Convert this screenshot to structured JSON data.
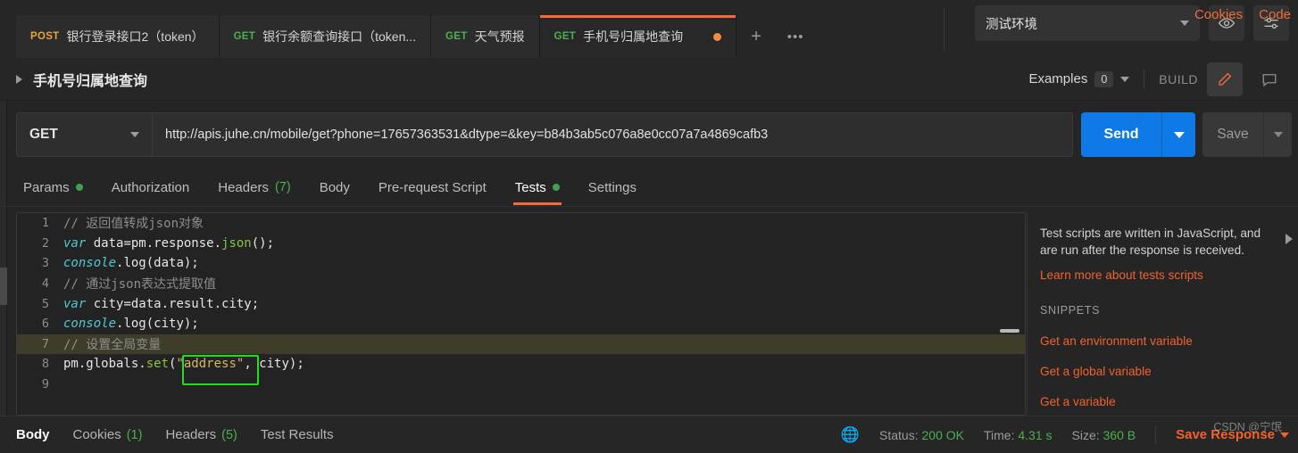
{
  "tabs": [
    {
      "method": "POST",
      "method_class": "m-post",
      "label": "银行登录接口2（token）",
      "active": false,
      "unsaved": false
    },
    {
      "method": "GET",
      "method_class": "m-get",
      "label": "银行余额查询接口（token...",
      "active": false,
      "unsaved": false
    },
    {
      "method": "GET",
      "method_class": "m-get",
      "label": "天气预报",
      "active": false,
      "unsaved": false
    },
    {
      "method": "GET",
      "method_class": "m-get",
      "label": "手机号归属地查询",
      "active": true,
      "unsaved": true
    }
  ],
  "tabbar": {
    "add_label": "+",
    "more_label": "•••"
  },
  "environment": {
    "selected": "测试环境",
    "eye_icon": "eye-icon",
    "settings_icon": "sliders-icon"
  },
  "request_header": {
    "title": "手机号归属地查询",
    "examples_label": "Examples",
    "examples_count": "0",
    "build_label": "BUILD",
    "edit_icon": "pencil-icon",
    "comment_icon": "comment-icon"
  },
  "url_bar": {
    "method": "GET",
    "url": "http://apis.juhe.cn/mobile/get?phone=17657363531&dtype=&key=b84b3ab5c076a8e0cc07a7a4869cafb3",
    "send_label": "Send",
    "save_label": "Save"
  },
  "request_tabs": [
    {
      "label": "Params",
      "dot": true,
      "count": "",
      "active": false
    },
    {
      "label": "Authorization",
      "dot": false,
      "count": "",
      "active": false
    },
    {
      "label": "Headers",
      "dot": false,
      "count": "(7)",
      "active": false
    },
    {
      "label": "Body",
      "dot": false,
      "count": "",
      "active": false
    },
    {
      "label": "Pre-request Script",
      "dot": false,
      "count": "",
      "active": false
    },
    {
      "label": "Tests",
      "dot": true,
      "count": "",
      "active": true
    },
    {
      "label": "Settings",
      "dot": false,
      "count": "",
      "active": false
    }
  ],
  "right_links": {
    "cookies": "Cookies",
    "code": "Code"
  },
  "editor": {
    "lines": [
      {
        "n": "1",
        "highlight": false,
        "tokens": [
          {
            "t": "// 返回值转成json对象",
            "c": "c-comment"
          }
        ]
      },
      {
        "n": "2",
        "highlight": false,
        "tokens": [
          {
            "t": "var",
            "c": "c-kw"
          },
          {
            "t": " data=pm.response.",
            "c": "c-plain"
          },
          {
            "t": "json",
            "c": "c-fn"
          },
          {
            "t": "();",
            "c": "c-plain"
          }
        ]
      },
      {
        "n": "3",
        "highlight": false,
        "tokens": [
          {
            "t": "console",
            "c": "c-obj"
          },
          {
            "t": ".log(data);",
            "c": "c-plain"
          }
        ]
      },
      {
        "n": "4",
        "highlight": false,
        "tokens": [
          {
            "t": "// 通过json表达式提取值",
            "c": "c-comment"
          }
        ]
      },
      {
        "n": "5",
        "highlight": false,
        "tokens": [
          {
            "t": "var",
            "c": "c-kw"
          },
          {
            "t": " city=data.result.city;",
            "c": "c-plain"
          }
        ]
      },
      {
        "n": "6",
        "highlight": false,
        "tokens": [
          {
            "t": "console",
            "c": "c-obj"
          },
          {
            "t": ".log(city);",
            "c": "c-plain"
          }
        ]
      },
      {
        "n": "7",
        "highlight": true,
        "tokens": [
          {
            "t": "// 设置全局变量",
            "c": "c-comment"
          }
        ]
      },
      {
        "n": "8",
        "highlight": false,
        "tokens": [
          {
            "t": "pm.globals.",
            "c": "c-plain"
          },
          {
            "t": "set",
            "c": "c-fn"
          },
          {
            "t": "(",
            "c": "c-plain"
          },
          {
            "t": "\"address\"",
            "c": "c-str"
          },
          {
            "t": ", city);",
            "c": "c-plain"
          }
        ]
      },
      {
        "n": "9",
        "highlight": false,
        "tokens": [
          {
            "t": "",
            "c": "c-plain"
          }
        ]
      }
    ]
  },
  "side_panel": {
    "description": "Test scripts are written in JavaScript, and are run after the response is received.",
    "learn_more": "Learn more about tests scripts",
    "snippets_title": "SNIPPETS",
    "snippets": [
      "Get an environment variable",
      "Get a global variable",
      "Get a variable"
    ]
  },
  "response_tabs": [
    {
      "label": "Body",
      "count": "",
      "active": true
    },
    {
      "label": "Cookies",
      "count": "(1)",
      "active": false
    },
    {
      "label": "Headers",
      "count": "(5)",
      "active": false
    },
    {
      "label": "Test Results",
      "count": "",
      "active": false
    }
  ],
  "status_bar": {
    "globe_icon": "globe-icon",
    "status_label": "Status:",
    "status_value": "200 OK",
    "time_label": "Time:",
    "time_value": "4.31 s",
    "size_label": "Size:",
    "size_value": "360 B",
    "save_response": "Save Response"
  },
  "watermark": "CSDN @宁氓",
  "colors": {
    "accent_orange": "#f26b3a",
    "send_blue": "#0f7ae5",
    "success_green": "#4caf50",
    "highlight_box_green": "#22dd22"
  }
}
